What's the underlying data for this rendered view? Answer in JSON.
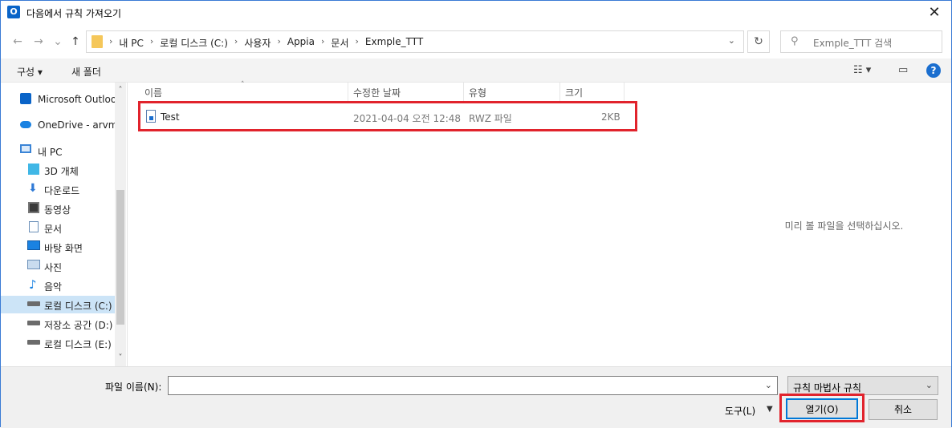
{
  "window": {
    "title": "다음에서 규칙 가져오기",
    "app_icon": "outlook-icon"
  },
  "address": {
    "crumbs": [
      "내 PC",
      "로컬 디스크 (C:)",
      "사용자",
      "Appia",
      "문서",
      "Exmple_TTT"
    ],
    "search_placeholder": "Exmple_TTT 검색"
  },
  "commandbar": {
    "organize": "구성 ▾",
    "new_folder": "새 폴더"
  },
  "nav": [
    {
      "label": "Microsoft Outlook",
      "icon": "outlook-icon"
    },
    {
      "label": "OneDrive - arvmc",
      "icon": "cloud-icon"
    },
    {
      "label": "내 PC",
      "icon": "computer-icon"
    },
    {
      "label": "3D 개체",
      "icon": "3d-objects-icon"
    },
    {
      "label": "다운로드",
      "icon": "download-icon"
    },
    {
      "label": "동영상",
      "icon": "video-icon"
    },
    {
      "label": "문서",
      "icon": "document-icon"
    },
    {
      "label": "바탕 화면",
      "icon": "desktop-icon"
    },
    {
      "label": "사진",
      "icon": "pictures-icon"
    },
    {
      "label": "음악",
      "icon": "music-icon"
    },
    {
      "label": "로컬 디스크 (C:)",
      "icon": "drive-icon"
    },
    {
      "label": "저장소 공간 (D:)",
      "icon": "drive-icon"
    },
    {
      "label": "로컬 디스크 (E:)",
      "icon": "drive-icon"
    }
  ],
  "columns": {
    "name": "이름",
    "date": "수정한 날짜",
    "type": "유형",
    "size": "크기"
  },
  "files": [
    {
      "name": "Test",
      "date": "2021-04-04 오전 12:48",
      "type": "RWZ 파일",
      "size": "2KB"
    }
  ],
  "preview": {
    "message": "미리 볼 파일을 선택하십시오."
  },
  "bottom": {
    "filename_label": "파일 이름(N):",
    "filename_value": "",
    "filetype": "규칙 마법사 규칙",
    "tools": "도구(L)",
    "open": "열기(O)",
    "cancel": "취소"
  },
  "colors": {
    "accent": "#0078d7",
    "highlight": "#e1232c",
    "selection": "#cce4f7"
  }
}
